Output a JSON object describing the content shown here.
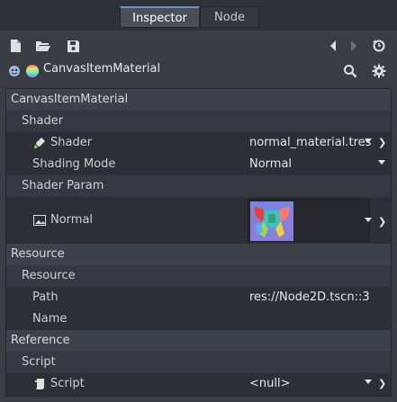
{
  "tabs": [
    {
      "label": "Inspector",
      "active": true
    },
    {
      "label": "Node",
      "active": false
    }
  ],
  "toolbar": {
    "icons": [
      "new-resource-icon",
      "open-resource-icon",
      "save-resource-icon",
      "history-back-icon",
      "history-forward-icon",
      "object-history-icon"
    ]
  },
  "object": {
    "title": "CanvasItemMaterial",
    "icons": [
      "object-type-icon",
      "material-icon",
      "search-icon",
      "gear-icon"
    ]
  },
  "inspector": {
    "section_material": "CanvasItemMaterial",
    "sub_shader": "Shader",
    "shader_label": "Shader",
    "shader_value": "normal_material.tres",
    "shading_mode_label": "Shading Mode",
    "shading_mode_value": "Normal",
    "sub_shader_param": "Shader Param",
    "normal_label": "Normal",
    "section_resource": "Resource",
    "sub_resource": "Resource",
    "path_label": "Path",
    "path_value": "res://Node2D.tscn::3",
    "name_label": "Name",
    "name_value": "",
    "section_reference": "Reference",
    "sub_script": "Script",
    "script_label": "Script",
    "script_value": "<null>"
  },
  "colors": {
    "accent": "#6b93c7",
    "background": "#3a3d44",
    "panel": "#2c2f35",
    "section": "#3d414a"
  }
}
